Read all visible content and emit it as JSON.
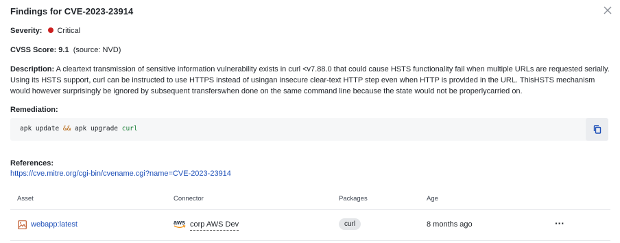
{
  "dialog": {
    "title": "Findings for CVE-2023-23914",
    "close_icon": "close-icon"
  },
  "severity": {
    "label": "Severity:",
    "value": "Critical",
    "color": "#cc1f1f"
  },
  "cvss": {
    "label": "CVSS Score: 9.1",
    "source": "(source: NVD)"
  },
  "description": {
    "label": "Description:",
    "text": " A cleartext transmission of sensitive information vulnerability exists in curl <v7.88.0 that could cause HSTS functionality fail when multiple URLs are requested serially. Using its HSTS support, curl can be instructed to use HTTPS instead of usingan insecure clear-text HTTP step even when HTTP is provided in the URL. ThisHSTS mechanism would however surprisingly be ignored by subsequent transferswhen done on the same command line because the state would not be properlycarried on."
  },
  "remediation": {
    "label": "Remediation:",
    "cmd1": "apk update ",
    "op": "&&",
    "cmd2": " apk upgrade ",
    "pkg": "curl",
    "copy_icon": "copy-icon"
  },
  "references": {
    "label": "References:",
    "url": "https://cve.mitre.org/cgi-bin/cvename.cgi?name=CVE-2023-23914"
  },
  "table": {
    "headers": [
      "Asset",
      "Connector",
      "Packages",
      "Age"
    ],
    "rows": [
      {
        "asset": "webapp:latest",
        "connector_logo": "aws",
        "connector": "corp AWS Dev",
        "package": "curl",
        "age": "8 months ago",
        "more_icon": "more-icon"
      }
    ]
  },
  "colors": {
    "link": "#1d4fb8",
    "critical": "#cc1f1f",
    "code_op": "#b35c00",
    "code_pkg": "#1a7f37"
  }
}
